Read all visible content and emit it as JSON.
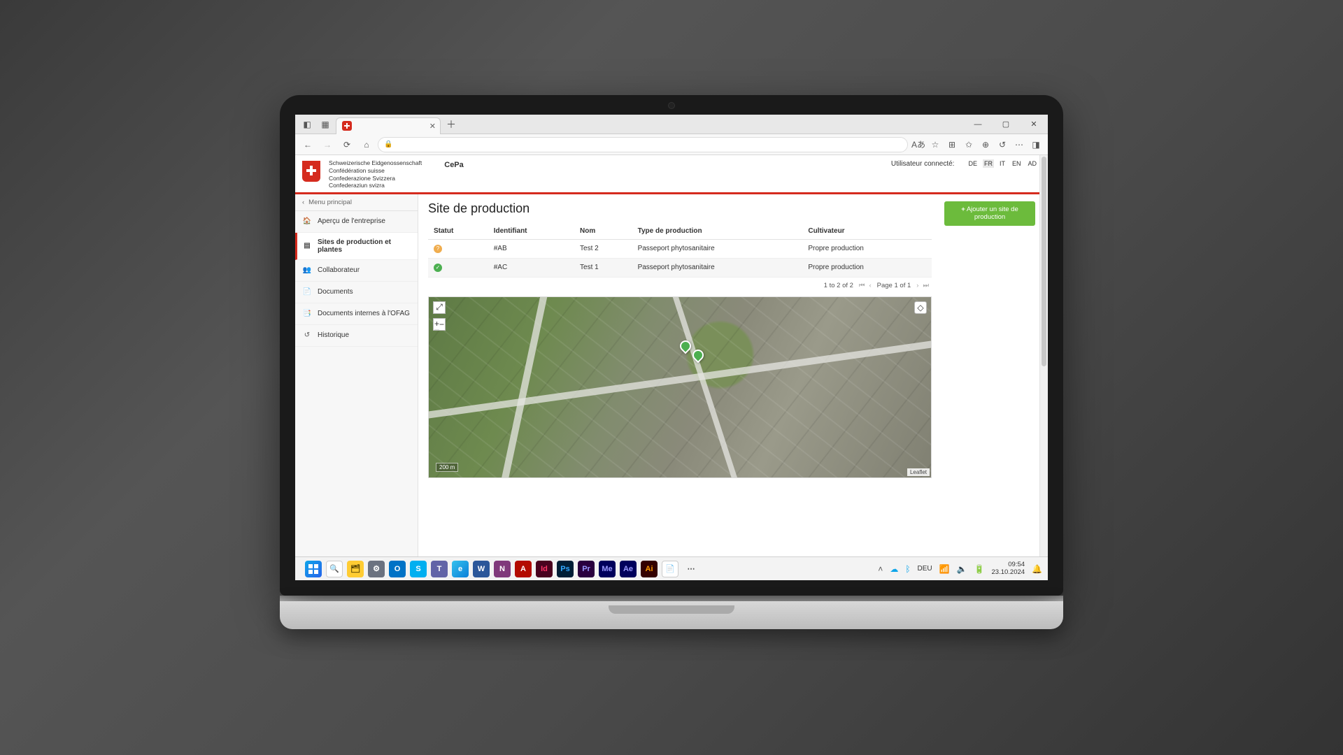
{
  "browser": {
    "tab_title": "",
    "window_controls": {
      "min": "—",
      "max": "▢",
      "close": "✕"
    }
  },
  "toolbar": {
    "lock_icon": "🔒"
  },
  "confederation_lines": [
    "Schweizerische Eidgenossenschaft",
    "Confédération suisse",
    "Confederazione Svizzera",
    "Confederaziun svizra"
  ],
  "app_name": "CePa",
  "user_label": "Utilisateur connecté:",
  "languages": [
    "DE",
    "FR",
    "IT",
    "EN",
    "AD"
  ],
  "active_language": "FR",
  "sidebar": {
    "back_label": "Menu principal",
    "items": [
      {
        "label": "Aperçu de l'entreprise",
        "icon": "home"
      },
      {
        "label": "Sites de production et plantes",
        "icon": "layers",
        "active": true
      },
      {
        "label": "Collaborateur",
        "icon": "users"
      },
      {
        "label": "Documents",
        "icon": "docs"
      },
      {
        "label": "Documents internes à l'OFAG",
        "icon": "docs-lock"
      },
      {
        "label": "Historique",
        "icon": "history"
      }
    ]
  },
  "page": {
    "title": "Site de production",
    "add_button": "Ajouter un site de production",
    "columns": [
      "Statut",
      "Identifiant",
      "Nom",
      "Type de production",
      "Cultivateur"
    ],
    "rows": [
      {
        "status": "warn",
        "id": "#AB",
        "name": "Test 2",
        "type": "Passeport phytosanitaire",
        "grower": "Propre production"
      },
      {
        "status": "ok",
        "id": "#AC",
        "name": "Test 1",
        "type": "Passeport phytosanitaire",
        "grower": "Propre production"
      }
    ],
    "pager": {
      "summary": "1 to 2 of 2",
      "page_label": "Page 1 of 1"
    }
  },
  "map": {
    "scale": "200 m",
    "attribution": "Leaflet"
  },
  "taskbar": {
    "overflow": "⋯",
    "lang": "DEU",
    "time": "09:54",
    "date": "23.10.2024"
  }
}
